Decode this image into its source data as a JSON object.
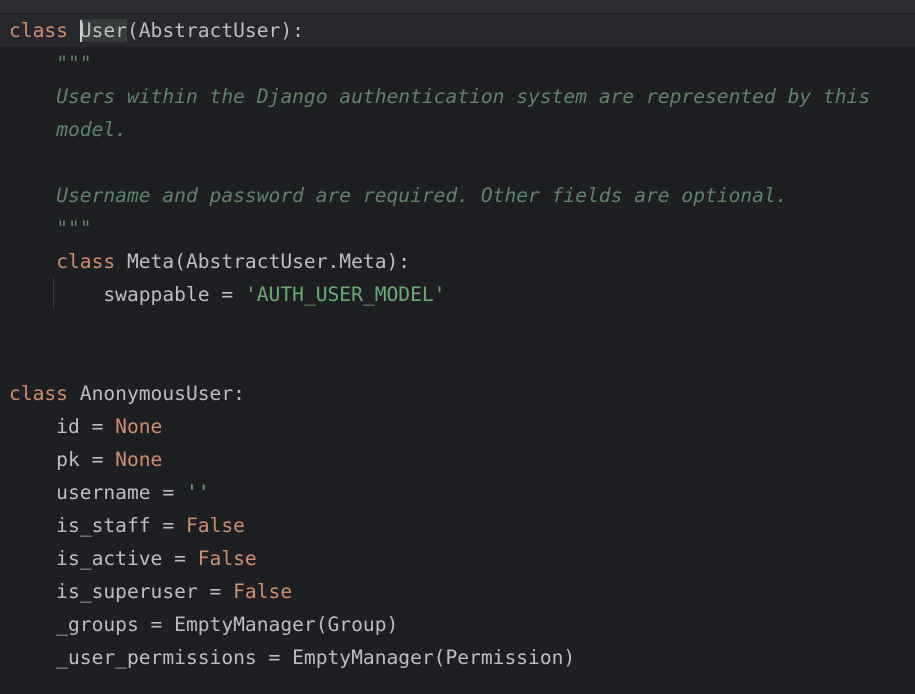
{
  "editor": {
    "lines": [
      {
        "tokens": [
          {
            "t": "class",
            "c": "kw"
          },
          {
            "t": " ",
            "c": "ident"
          },
          {
            "t": "User",
            "c": "ident",
            "caret": true,
            "hl": true
          },
          {
            "t": "(AbstractUser):",
            "c": "ident"
          }
        ],
        "current": true
      },
      {
        "tokens": [
          {
            "t": "    ",
            "c": "ident"
          },
          {
            "t": "\"\"\"",
            "c": "doc"
          }
        ]
      },
      {
        "tokens": [
          {
            "t": "    ",
            "c": "ident"
          },
          {
            "t": "Users within the Django authentication system are represented by this",
            "c": "doc"
          }
        ]
      },
      {
        "tokens": [
          {
            "t": "    ",
            "c": "ident"
          },
          {
            "t": "model.",
            "c": "doc"
          }
        ]
      },
      {
        "tokens": []
      },
      {
        "tokens": [
          {
            "t": "    ",
            "c": "ident"
          },
          {
            "t": "Username and password are required. Other fields are optional.",
            "c": "doc"
          }
        ]
      },
      {
        "tokens": [
          {
            "t": "    ",
            "c": "ident"
          },
          {
            "t": "\"\"\"",
            "c": "doc"
          }
        ]
      },
      {
        "tokens": [
          {
            "t": "    ",
            "c": "ident"
          },
          {
            "t": "class",
            "c": "kw"
          },
          {
            "t": " Meta(AbstractUser.Meta):",
            "c": "ident"
          }
        ]
      },
      {
        "tokens": [
          {
            "t": "        swappable = ",
            "c": "ident"
          },
          {
            "t": "'AUTH_USER_MODEL'",
            "c": "str"
          }
        ]
      },
      {
        "tokens": []
      },
      {
        "tokens": []
      },
      {
        "tokens": [
          {
            "t": "class",
            "c": "kw"
          },
          {
            "t": " AnonymousUser:",
            "c": "ident"
          }
        ]
      },
      {
        "tokens": [
          {
            "t": "    id = ",
            "c": "ident"
          },
          {
            "t": "None",
            "c": "const"
          }
        ]
      },
      {
        "tokens": [
          {
            "t": "    pk = ",
            "c": "ident"
          },
          {
            "t": "None",
            "c": "const"
          }
        ]
      },
      {
        "tokens": [
          {
            "t": "    username = ",
            "c": "ident"
          },
          {
            "t": "''",
            "c": "str"
          }
        ]
      },
      {
        "tokens": [
          {
            "t": "    is_staff = ",
            "c": "ident"
          },
          {
            "t": "False",
            "c": "const"
          }
        ]
      },
      {
        "tokens": [
          {
            "t": "    is_active = ",
            "c": "ident"
          },
          {
            "t": "False",
            "c": "const"
          }
        ]
      },
      {
        "tokens": [
          {
            "t": "    is_superuser = ",
            "c": "ident"
          },
          {
            "t": "False",
            "c": "const"
          }
        ]
      },
      {
        "tokens": [
          {
            "t": "    _groups = EmptyManager(Group)",
            "c": "ident"
          }
        ]
      },
      {
        "tokens": [
          {
            "t": "    _user_permissions = EmptyManager(Permission)",
            "c": "ident"
          }
        ]
      }
    ]
  },
  "colors": {
    "background": "#1e1f22",
    "keyword": "#cf8e6d",
    "docstring": "#5f826b",
    "string": "#6aab73",
    "text": "#bcbec4"
  }
}
